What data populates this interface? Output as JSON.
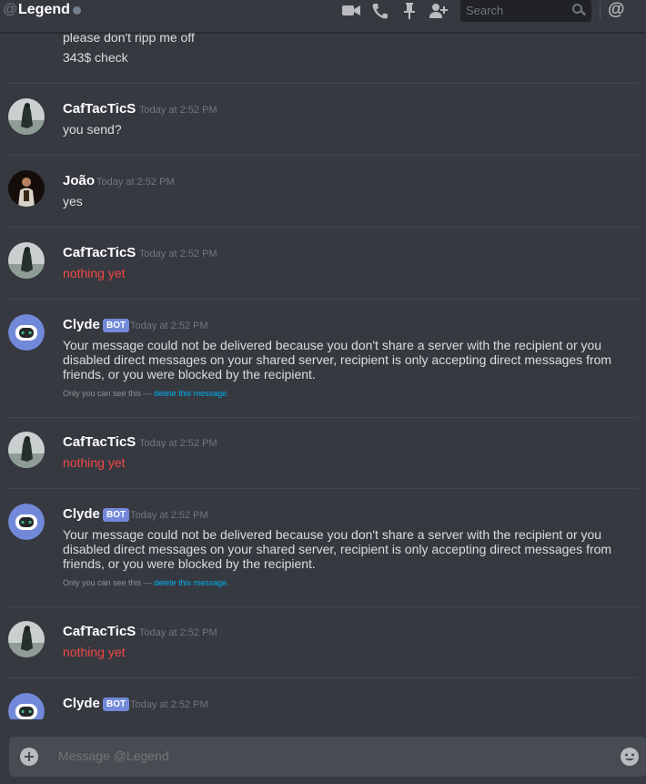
{
  "header": {
    "at_symbol": "@",
    "channel_name": "Legend",
    "search_placeholder": "Search",
    "mention_symbol": "@"
  },
  "messages": {
    "top_partial": {
      "line1": "please don't ripp me off",
      "line2": "343$ check"
    },
    "g1": {
      "author": "CafTacTicS",
      "timestamp": "Today at 2:52 PM",
      "text": "you send?"
    },
    "g2": {
      "author": "João",
      "timestamp": "Today at 2:52 PM",
      "text": "yes"
    },
    "g3": {
      "author": "CafTacTicS",
      "timestamp": "Today at 2:52 PM",
      "text": "nothing yet"
    },
    "g4": {
      "author": "Clyde",
      "badge": "BOT",
      "timestamp": "Today at 2:52 PM",
      "text": "Your message could not be delivered because you don't share a server with the recipient or you disabled direct messages on your shared server, recipient is only accepting direct messages from friends, or you were blocked by the recipient.",
      "ephemeral_note": "Only you can see this — ",
      "delete_link": "delete this message."
    },
    "g5": {
      "author": "CafTacTicS",
      "timestamp": "Today at 2:52 PM",
      "text": "nothing yet"
    },
    "g6": {
      "author": "Clyde",
      "badge": "BOT",
      "timestamp": "Today at 2:52 PM",
      "text": "Your message could not be delivered because you don't share a server with the recipient or you disabled direct messages on your shared server, recipient is only accepting direct messages from friends, or you were blocked by the recipient.",
      "ephemeral_note": "Only you can see this — ",
      "delete_link": "delete this message."
    },
    "g7": {
      "author": "CafTacTicS",
      "timestamp": "Today at 2:52 PM",
      "text": "nothing yet"
    },
    "g8": {
      "author": "Clyde",
      "badge": "BOT",
      "timestamp": "Today at 2:52 PM"
    }
  },
  "composer": {
    "placeholder": "Message @Legend"
  },
  "colors": {
    "background": "#36393f",
    "accent_bot": "#7289da",
    "error_red": "#f04747",
    "link_blue": "#00b0f4"
  },
  "icons": [
    "video-call-icon",
    "phone-call-icon",
    "pin-icon",
    "add-friend-icon",
    "search-icon",
    "mention-icon",
    "add-attachment-icon",
    "emoji-icon"
  ]
}
